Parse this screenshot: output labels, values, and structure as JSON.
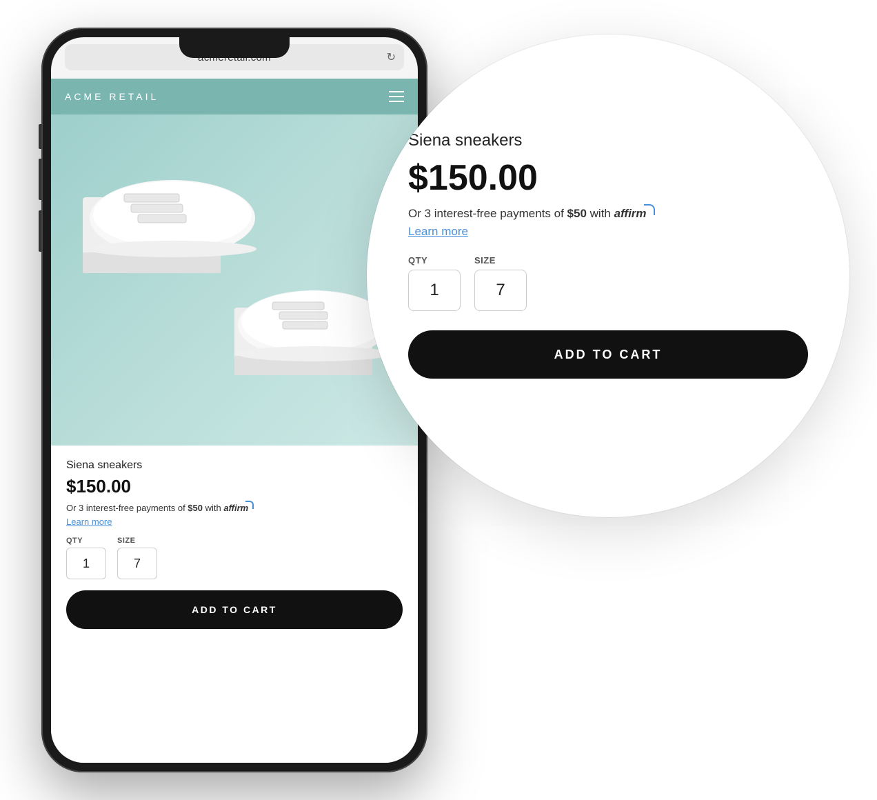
{
  "phone": {
    "url": "acmeretail.com",
    "store_name": "ACME RETAIL",
    "product_name": "Siena sneakers",
    "price": "$150.00",
    "affirm_text_prefix": "Or 3 interest-free payments of ",
    "affirm_amount": "$50",
    "affirm_text_middle": " with ",
    "affirm_brand": "affirm",
    "learn_more": "Learn more",
    "qty_label": "QTY",
    "size_label": "SIZE",
    "qty_value": "1",
    "size_value": "7",
    "add_to_cart": "ADD TO CART"
  },
  "zoom": {
    "product_name": "Siena sneakers",
    "price": "$150.00",
    "affirm_text_prefix": "Or 3 interest-free payments of ",
    "affirm_amount": "$50",
    "affirm_text_middle": " with ",
    "affirm_brand": "affirm",
    "learn_more": "Learn more",
    "qty_label": "QTY",
    "size_label": "SIZE",
    "qty_value": "1",
    "size_value": "7",
    "add_to_cart": "ADD TO CART"
  },
  "icons": {
    "reload": "↻",
    "hamburger": "≡"
  }
}
